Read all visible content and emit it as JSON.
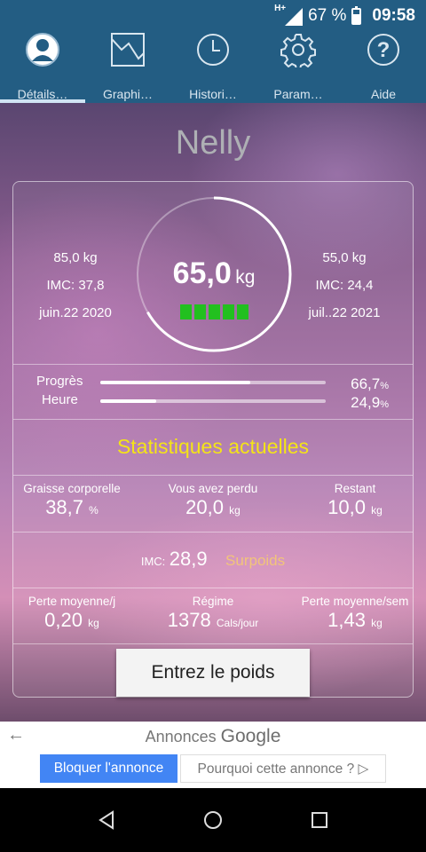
{
  "status_bar": {
    "network": "H+",
    "battery": "67 %",
    "time": "09:58"
  },
  "tabs": [
    {
      "label": "Détails…",
      "icon": "user-icon",
      "active": true
    },
    {
      "label": "Graphi…",
      "icon": "chart-icon",
      "active": false
    },
    {
      "label": "Histori…",
      "icon": "clock-icon",
      "active": false
    },
    {
      "label": "Param…",
      "icon": "gear-icon",
      "active": false
    },
    {
      "label": "Aide",
      "icon": "help-icon",
      "active": false
    }
  ],
  "profile": {
    "name": "Nelly"
  },
  "start": {
    "weight": "85,0 kg",
    "imc": "IMC: 37,8",
    "date": "juin.22 2020"
  },
  "goal": {
    "weight": "55,0 kg",
    "imc": "IMC: 24,4",
    "date": "juil..22 2021"
  },
  "current": {
    "weight": "65,0",
    "unit": "kg",
    "level_bars": 5,
    "ring_fraction": 0.667
  },
  "progress": {
    "progress_label": "Progrès",
    "progress_value": "66,7",
    "progress_fraction": 0.667,
    "time_label": "Heure",
    "time_value": "24,9",
    "time_fraction": 0.249,
    "pct_unit": "%"
  },
  "stats": {
    "title": "Statistiques actuelles",
    "body_fat": {
      "label": "Graisse corporelle",
      "value": "38,7",
      "unit": "%"
    },
    "lost": {
      "label": "Vous avez perdu",
      "value": "20,0",
      "unit": "kg"
    },
    "remaining": {
      "label": "Restant",
      "value": "10,0",
      "unit": "kg"
    },
    "imc": {
      "label": "IMC:",
      "value": "28,9",
      "status": "Surpoids"
    },
    "avg_day": {
      "label": "Perte moyenne/j",
      "value": "0,20",
      "unit": "kg"
    },
    "diet": {
      "label": "Régime",
      "value": "1378",
      "unit": "Cals/jour"
    },
    "avg_week": {
      "label": "Perte moyenne/sem",
      "value": "1,43",
      "unit": "kg"
    }
  },
  "actions": {
    "enter_weight": "Entrez le poids"
  },
  "ad": {
    "title_prefix": "Annonces",
    "title_brand": "Google",
    "block_label": "Bloquer l'annonce",
    "why_label": "Pourquoi cette annonce ? ▷"
  },
  "colors": {
    "header": "#235d83",
    "stats_title": "#f4e417",
    "status_overweight": "#f2c47a",
    "level_bar": "#22c01f",
    "ad_button": "#4285f4"
  }
}
